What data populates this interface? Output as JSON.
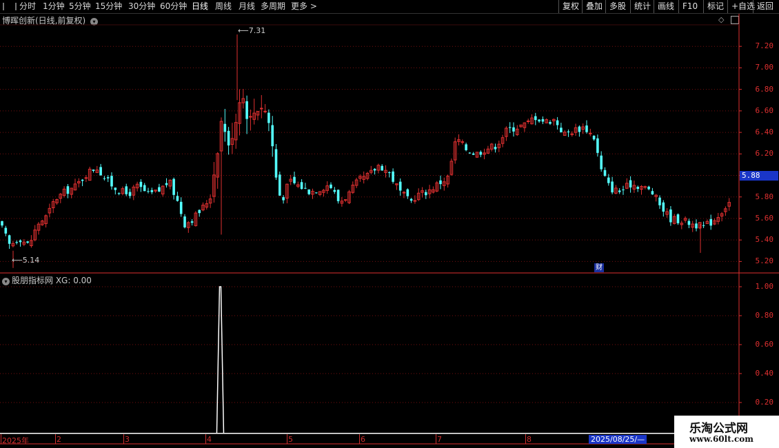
{
  "toolbar": {
    "periods": [
      "分时",
      "1分钟",
      "5分钟",
      "15分钟",
      "30分钟",
      "60分钟",
      "日线",
      "周线",
      "月线",
      "多周期",
      "更多 >"
    ],
    "active_period": "日线",
    "actions": [
      "复权",
      "叠加",
      "多股",
      "统计",
      "画线",
      "F10",
      "标记",
      "+自选",
      "返回"
    ]
  },
  "main_panel": {
    "title": "博晖创新(日线,前复权)",
    "high_marker": "7.31",
    "low_marker": "5.14",
    "current_price": "5.88",
    "finance_badge": "财",
    "y_axis": [
      "7.20",
      "7.00",
      "6.80",
      "6.60",
      "6.40",
      "6.20",
      "6.00",
      "5.80",
      "5.60",
      "5.40",
      "5.20"
    ]
  },
  "indicator_panel": {
    "title": "股朋指标网 XG: 0.00",
    "y_axis": [
      "1.00",
      "0.80",
      "0.60",
      "0.40",
      "0.20"
    ]
  },
  "date_axis": {
    "labels": [
      "2025年",
      "2",
      "3",
      "4",
      "5",
      "6",
      "7",
      "8"
    ],
    "cursor_date": "2025/08/25/—"
  },
  "watermark": {
    "title": "乐淘公式网",
    "url": "www.60lt.com"
  },
  "colors": {
    "up": "#e03030",
    "down": "#54ffff",
    "grid": "#7a1010",
    "background": "#000000",
    "price_tag": "#1a36c8"
  },
  "chart_data": {
    "type": "candlestick",
    "price_range": [
      5.1,
      7.4
    ],
    "high": 7.31,
    "low": 5.14,
    "last_close": 5.88,
    "close_path": [
      [
        0,
        5.55
      ],
      [
        14,
        5.35
      ],
      [
        28,
        5.42
      ],
      [
        42,
        5.35
      ],
      [
        55,
        5.55
      ],
      [
        68,
        5.62
      ],
      [
        80,
        5.78
      ],
      [
        95,
        5.85
      ],
      [
        110,
        5.9
      ],
      [
        126,
        6.02
      ],
      [
        140,
        6.08
      ],
      [
        155,
        5.95
      ],
      [
        170,
        5.87
      ],
      [
        185,
        5.82
      ],
      [
        200,
        5.9
      ],
      [
        215,
        5.82
      ],
      [
        230,
        5.85
      ],
      [
        245,
        5.95
      ],
      [
        258,
        5.75
      ],
      [
        268,
        5.55
      ],
      [
        280,
        5.6
      ],
      [
        292,
        5.68
      ],
      [
        305,
        5.8
      ],
      [
        315,
        6.2
      ],
      [
        322,
        6.55
      ],
      [
        332,
        6.25
      ],
      [
        342,
        6.5
      ],
      [
        350,
        6.8
      ],
      [
        360,
        6.5
      ],
      [
        370,
        6.6
      ],
      [
        382,
        6.65
      ],
      [
        392,
        6.45
      ],
      [
        400,
        6.0
      ],
      [
        408,
        5.75
      ],
      [
        420,
        5.95
      ],
      [
        435,
        5.9
      ],
      [
        450,
        5.85
      ],
      [
        465,
        5.88
      ],
      [
        478,
        5.92
      ],
      [
        492,
        5.75
      ],
      [
        505,
        5.82
      ],
      [
        520,
        5.95
      ],
      [
        535,
        6.0
      ],
      [
        550,
        6.1
      ],
      [
        565,
        6.02
      ],
      [
        580,
        5.85
      ],
      [
        595,
        5.75
      ],
      [
        605,
        5.82
      ],
      [
        620,
        5.85
      ],
      [
        635,
        5.92
      ],
      [
        650,
        5.98
      ],
      [
        662,
        6.35
      ],
      [
        675,
        6.25
      ],
      [
        690,
        6.2
      ],
      [
        705,
        6.25
      ],
      [
        720,
        6.28
      ],
      [
        735,
        6.42
      ],
      [
        750,
        6.45
      ],
      [
        765,
        6.48
      ],
      [
        775,
        6.55
      ],
      [
        790,
        6.5
      ],
      [
        805,
        6.52
      ],
      [
        818,
        6.38
      ],
      [
        832,
        6.42
      ],
      [
        848,
        6.45
      ],
      [
        862,
        6.35
      ],
      [
        872,
        6.05
      ],
      [
        885,
        5.88
      ],
      [
        900,
        5.85
      ],
      [
        915,
        5.92
      ],
      [
        930,
        5.9
      ],
      [
        945,
        5.85
      ],
      [
        958,
        5.72
      ],
      [
        972,
        5.6
      ],
      [
        990,
        5.58
      ],
      [
        1005,
        5.55
      ],
      [
        1020,
        5.52
      ],
      [
        1035,
        5.58
      ],
      [
        1048,
        5.68
      ],
      [
        1058,
        5.75
      ]
    ]
  },
  "xg_signal": {
    "signal_index_fraction": 0.298,
    "peak_value": 1.0
  }
}
